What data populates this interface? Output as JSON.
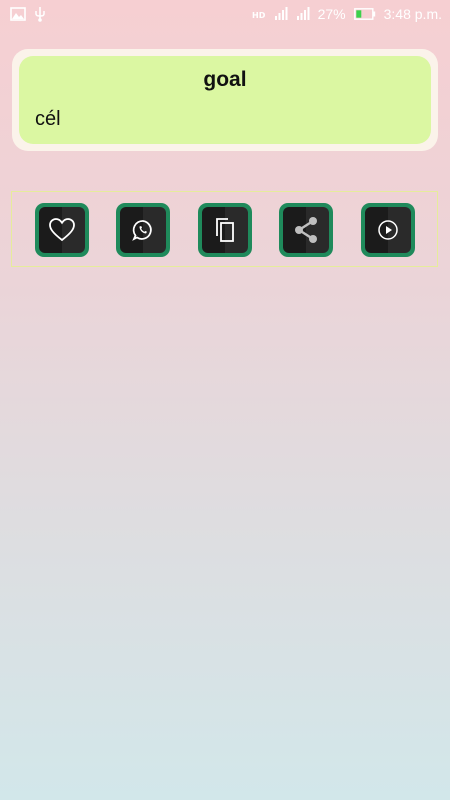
{
  "status_bar": {
    "battery_percent": "27%",
    "time": "3:48 p.m.",
    "icons": [
      "image-icon",
      "usb-icon",
      "hd-icon",
      "signal-icon",
      "signal-icon",
      "battery-icon"
    ]
  },
  "card": {
    "word": "goal",
    "translation": "cél"
  },
  "actions": [
    {
      "name": "favorite",
      "icon": "heart-icon"
    },
    {
      "name": "whatsapp",
      "icon": "whatsapp-icon"
    },
    {
      "name": "copy",
      "icon": "copy-icon"
    },
    {
      "name": "share",
      "icon": "share-icon"
    },
    {
      "name": "play",
      "icon": "play-icon"
    }
  ],
  "colors": {
    "card_fill": "#dbf7a2",
    "button_accent": "#1f8a5b"
  }
}
